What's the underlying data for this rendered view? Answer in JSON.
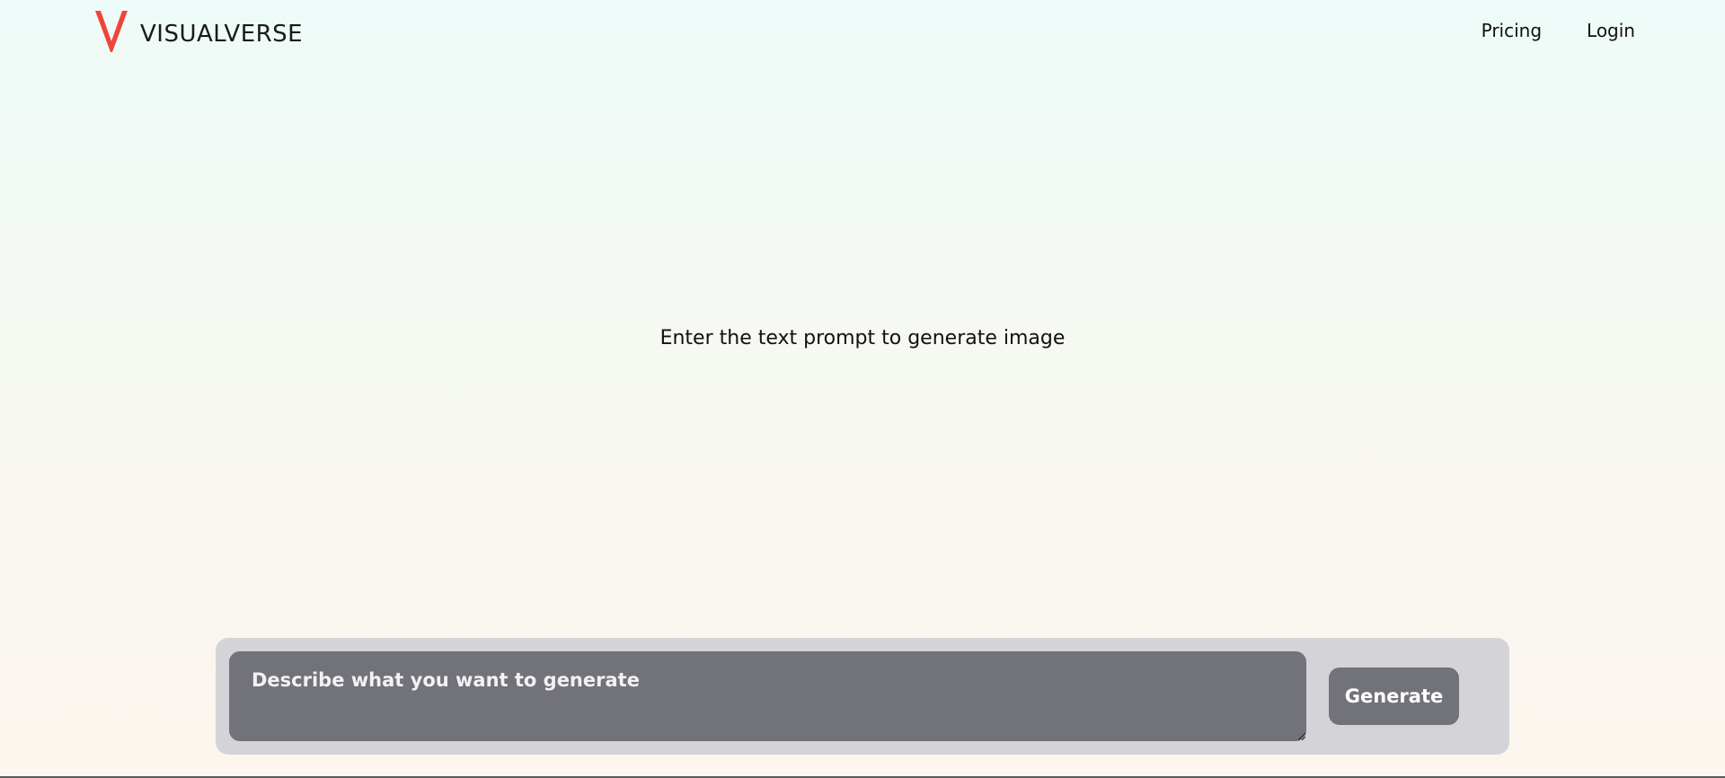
{
  "brand": {
    "name": "VISUALVERSE",
    "accent_color": "#f0443a"
  },
  "nav": {
    "items": [
      "Pricing",
      "Login"
    ]
  },
  "main": {
    "empty_message": "Enter the text prompt to generate image"
  },
  "prompt": {
    "placeholder": "Describe what you want to generate",
    "value": "",
    "submit_label": "Generate"
  },
  "colors": {
    "panel_bg": "#d4d3d8",
    "input_bg": "#72727a",
    "button_bg": "#72727a"
  }
}
